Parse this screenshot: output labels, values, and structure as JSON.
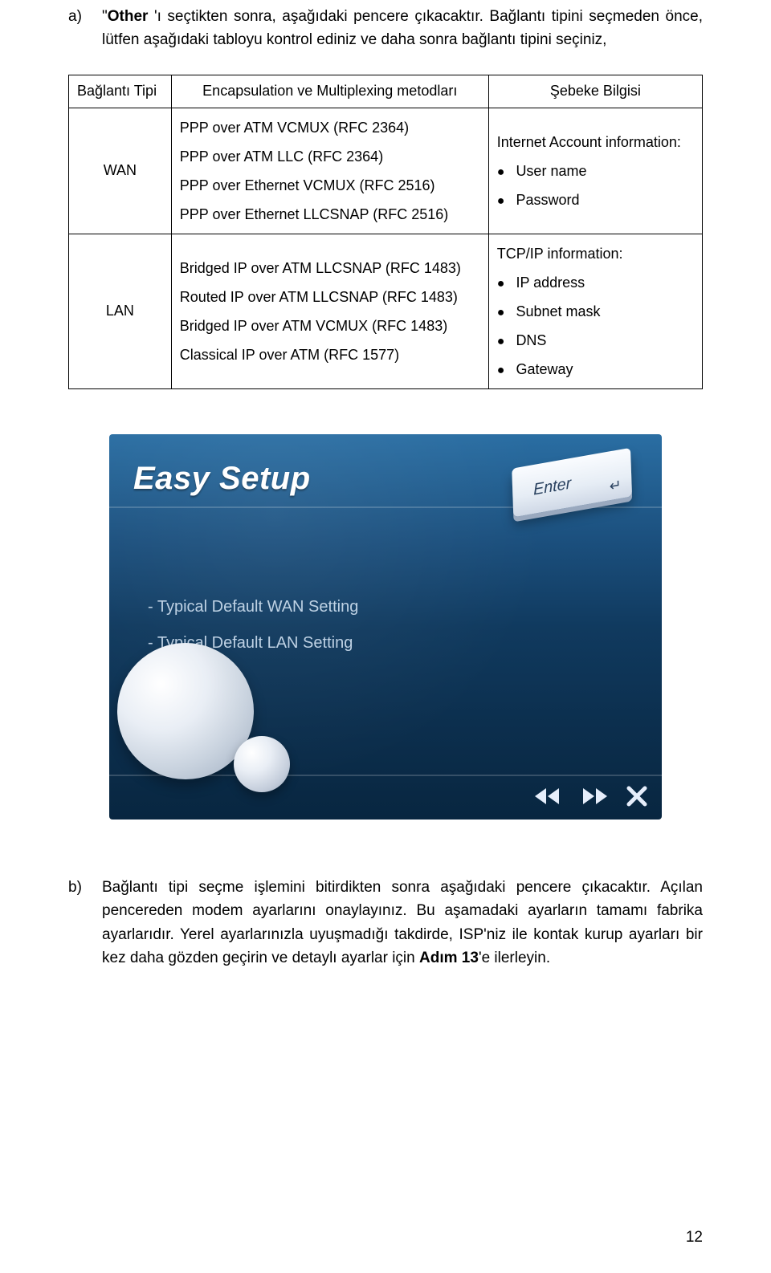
{
  "intro": {
    "a_marker": "a)",
    "a_sentence_prefix": "\"",
    "a_sentence_bold": "Other",
    "a_sentence_mid1": " 'ı seçtikten sonra, aşağıdaki pencere çıkacaktır. Bağlantı tipini seçmeden önce, lütfen aşağıdaki tabloyu kontrol ediniz ve daha sonra bağlantı tipini seçiniz,"
  },
  "table": {
    "header": {
      "col1": "Bağlantı Tipi",
      "col2": "Encapsulation ve Multiplexing metodları",
      "col3": "Şebeke Bilgisi"
    },
    "wan": {
      "label": "WAN",
      "methods": [
        "PPP over ATM VCMUX (RFC 2364)",
        "PPP over ATM LLC (RFC 2364)",
        "PPP over Ethernet VCMUX (RFC 2516)",
        "PPP over Ethernet LLCSNAP (RFC 2516)"
      ],
      "info_title": "Internet Account information:",
      "info_items": [
        "User name",
        "Password"
      ]
    },
    "lan": {
      "label": "LAN",
      "methods": [
        "Bridged IP over ATM LLCSNAP (RFC 1483)",
        "Routed IP over ATM LLCSNAP (RFC 1483)",
        "Bridged IP over ATM VCMUX (RFC 1483)",
        "Classical IP over ATM (RFC 1577)"
      ],
      "info_title": "TCP/IP information:",
      "info_items": [
        "IP address",
        "Subnet mask",
        "DNS",
        "Gateway"
      ]
    }
  },
  "easy_setup": {
    "title": "Easy Setup",
    "key_label": "Enter",
    "bullets": [
      "- Typical Default WAN Setting",
      "- Typical Default LAN Setting"
    ]
  },
  "outro": {
    "b_marker": "b)",
    "b_text_prefix": "Bağlantı tipi seçme işlemini bitirdikten sonra aşağıdaki pencere çıkacaktır. Açılan pencereden modem ayarlarını onaylayınız. Bu aşamadaki ayarların tamamı fabrika ayarlarıdır. Yerel ayarlarınızla uyuşmadığı takdirde, ISP'niz ile kontak kurup ayarları bir kez daha gözden geçirin ve detaylı ayarlar için ",
    "b_text_bold": "Adım 13",
    "b_text_suffix": "'e ilerleyin."
  },
  "page_number": "12"
}
